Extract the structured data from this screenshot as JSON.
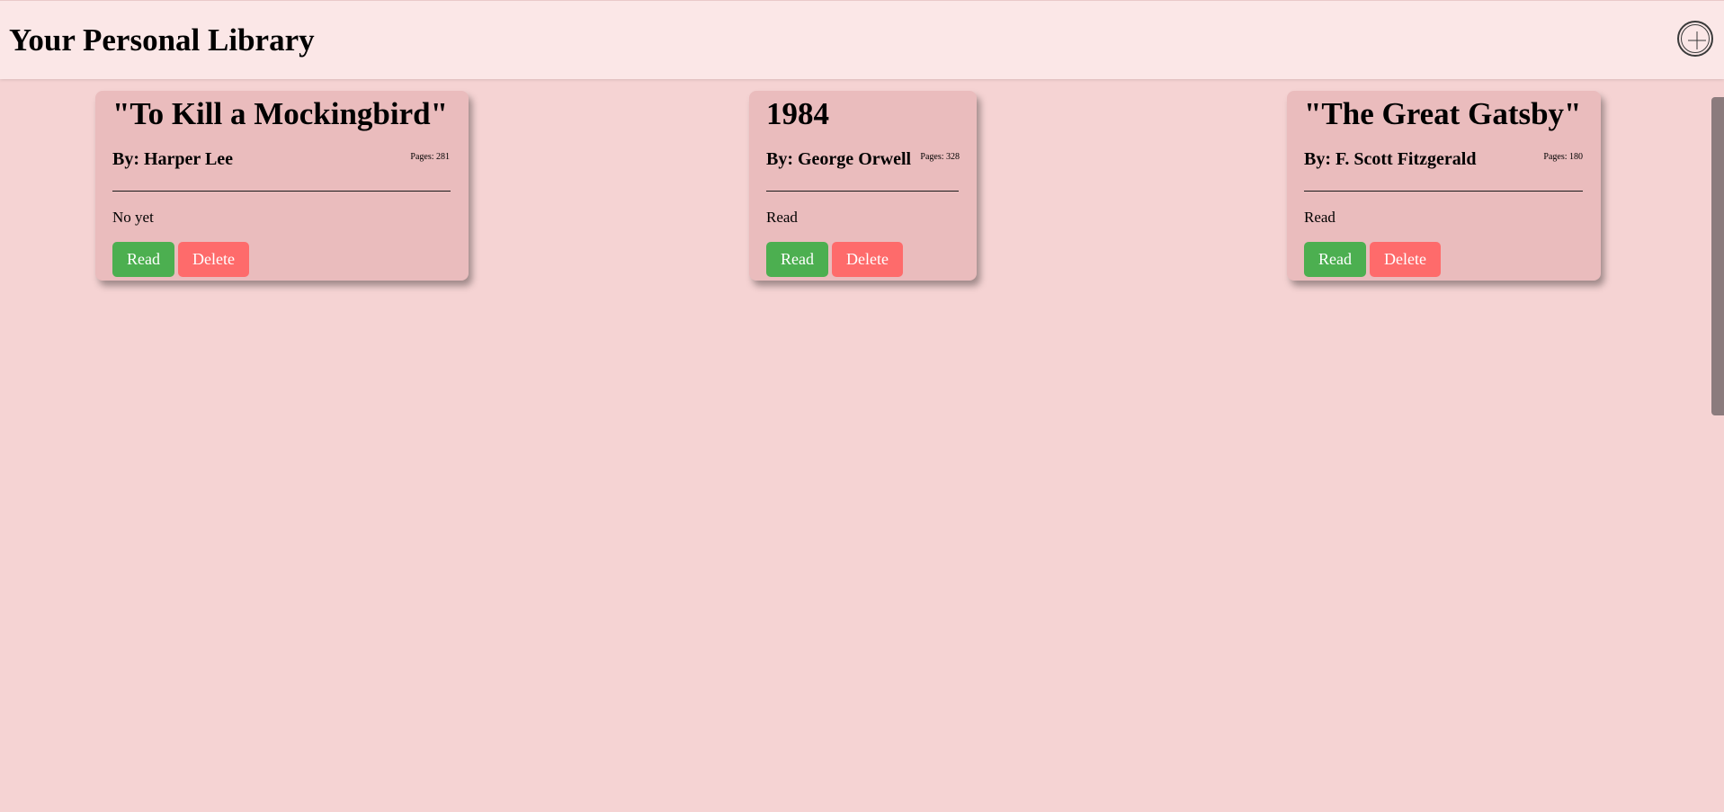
{
  "header": {
    "title": "Your Personal Library",
    "add_icon": "plus-circle-icon"
  },
  "books": [
    {
      "title": "\"To Kill a Mockingbird\"",
      "author": "By: Harper Lee",
      "pages": "Pages: 281",
      "status": "No yet",
      "read_label": "Read",
      "delete_label": "Delete"
    },
    {
      "title": "1984",
      "author": "By: George Orwell",
      "pages": "Pages: 328",
      "status": "Read",
      "read_label": "Read",
      "delete_label": "Delete"
    },
    {
      "title": "\"The Great Gatsby\"",
      "author": "By: F. Scott Fitzgerald",
      "pages": "Pages: 180",
      "status": "Read",
      "read_label": "Read",
      "delete_label": "Delete"
    }
  ],
  "colors": {
    "background": "#f5d3d3",
    "header": "#fbe7e7",
    "card": "#eabcbd",
    "read_button": "#4caf50",
    "delete_button": "#fe6b6b"
  }
}
